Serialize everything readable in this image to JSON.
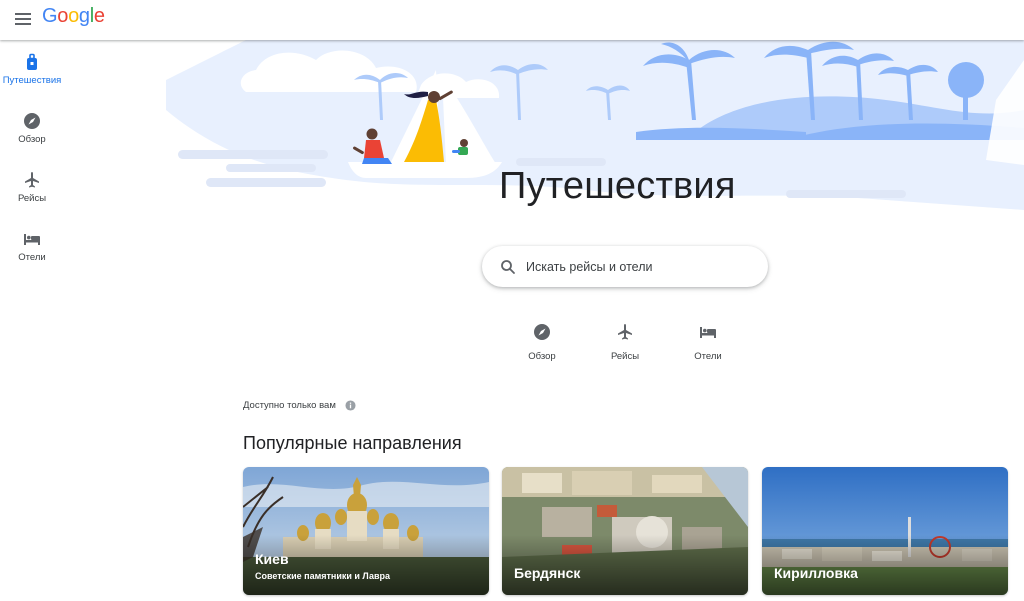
{
  "app": {
    "logo_letters": [
      "G",
      "o",
      "o",
      "g",
      "l",
      "e"
    ]
  },
  "sidebar": {
    "items": [
      {
        "label": "Путешествия",
        "icon": "luggage-icon",
        "active": true
      },
      {
        "label": "Обзор",
        "icon": "compass-icon",
        "active": false
      },
      {
        "label": "Рейсы",
        "icon": "airplane-icon",
        "active": false
      },
      {
        "label": "Отели",
        "icon": "bed-icon",
        "active": false
      }
    ]
  },
  "hero": {
    "title": "Путешествия"
  },
  "search": {
    "placeholder": "Искать рейсы и отели"
  },
  "quick_links": [
    {
      "label": "Обзор",
      "icon": "compass-icon"
    },
    {
      "label": "Рейсы",
      "icon": "airplane-icon"
    },
    {
      "label": "Отели",
      "icon": "bed-icon"
    }
  ],
  "private_note": {
    "text": "Доступно только вам",
    "icon": "info-icon"
  },
  "popular": {
    "title": "Популярные направления",
    "cards": [
      {
        "title": "Киев",
        "subtitle": "Советские памятники и Лавра"
      },
      {
        "title": "Бердянск",
        "subtitle": ""
      },
      {
        "title": "Кирилловка",
        "subtitle": ""
      }
    ]
  },
  "colors": {
    "accent": "#1a73e8",
    "icon_gray": "#5f6368",
    "hero_blue": "#aecbfa",
    "hero_light": "#e8f0fe"
  }
}
